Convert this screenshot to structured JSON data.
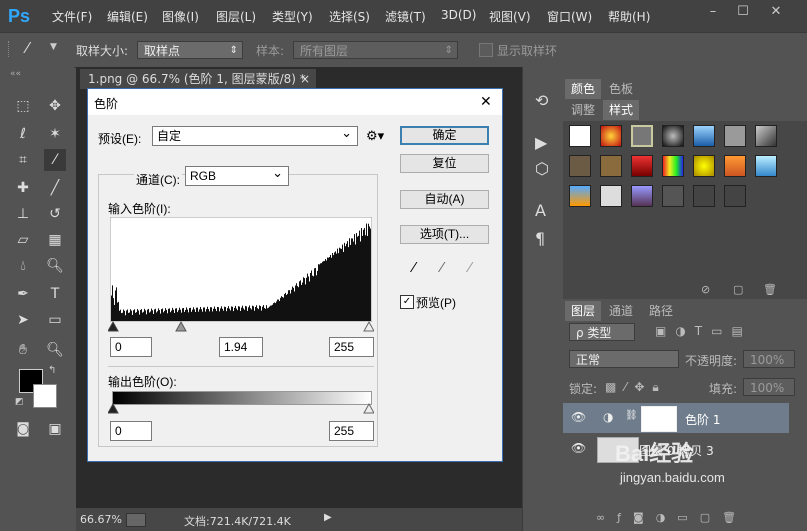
{
  "app": {
    "logo": "Ps",
    "menu": [
      "文件(F)",
      "编辑(E)",
      "图像(I)",
      "图层(L)",
      "类型(Y)",
      "选择(S)",
      "滤镜(T)",
      "3D(D)",
      "视图(V)",
      "窗口(W)",
      "帮助(H)"
    ],
    "window_controls": [
      "–",
      "☐",
      "✕"
    ]
  },
  "options_bar": {
    "sample_size_label": "取样大小:",
    "sample_size_value": "取样点",
    "sample_label": "样本:",
    "sample_value": "所有图层",
    "show_ring_label": "显示取样环"
  },
  "document": {
    "tab_title": "1.png @ 66.7% (色阶 1, 图层蒙版/8) *",
    "tab_close": "×"
  },
  "status": {
    "zoom": "66.67%",
    "doc_info": "文档:721.4K/721.4K"
  },
  "style_panel": {
    "tabs_row1": [
      "颜色",
      "色板"
    ],
    "tabs_row2": [
      "调整",
      "样式"
    ]
  },
  "layers_panel": {
    "tabs": [
      "图层",
      "通道",
      "路径"
    ],
    "filter_kind": "ρ 类型",
    "blend_mode": "正常",
    "opacity_label": "不透明度:",
    "opacity_value": "100%",
    "lock_label": "锁定:",
    "fill_label": "填充:",
    "fill_value": "100%",
    "layers": [
      {
        "name": "色阶 1",
        "selected": true
      },
      {
        "name": "图层 0 拷贝 3",
        "selected": false
      }
    ]
  },
  "dialog": {
    "title": "色阶",
    "close": "✕",
    "preset_label": "预设(E):",
    "preset_value": "自定",
    "channel_label": "通道(C):",
    "channel_value": "RGB",
    "input_levels_label": "输入色阶(I):",
    "input_black": "0",
    "input_gamma": "1.94",
    "input_white": "255",
    "output_levels_label": "输出色阶(O):",
    "output_black": "0",
    "output_white": "255",
    "buttons": {
      "ok": "确定",
      "reset": "复位",
      "auto": "自动(A)",
      "options": "选项(T)..."
    },
    "preview_label": "预览(P)",
    "preview_checked": true
  },
  "watermark": {
    "brand": "Bai经验",
    "url": "jingyan.baidu.com"
  }
}
